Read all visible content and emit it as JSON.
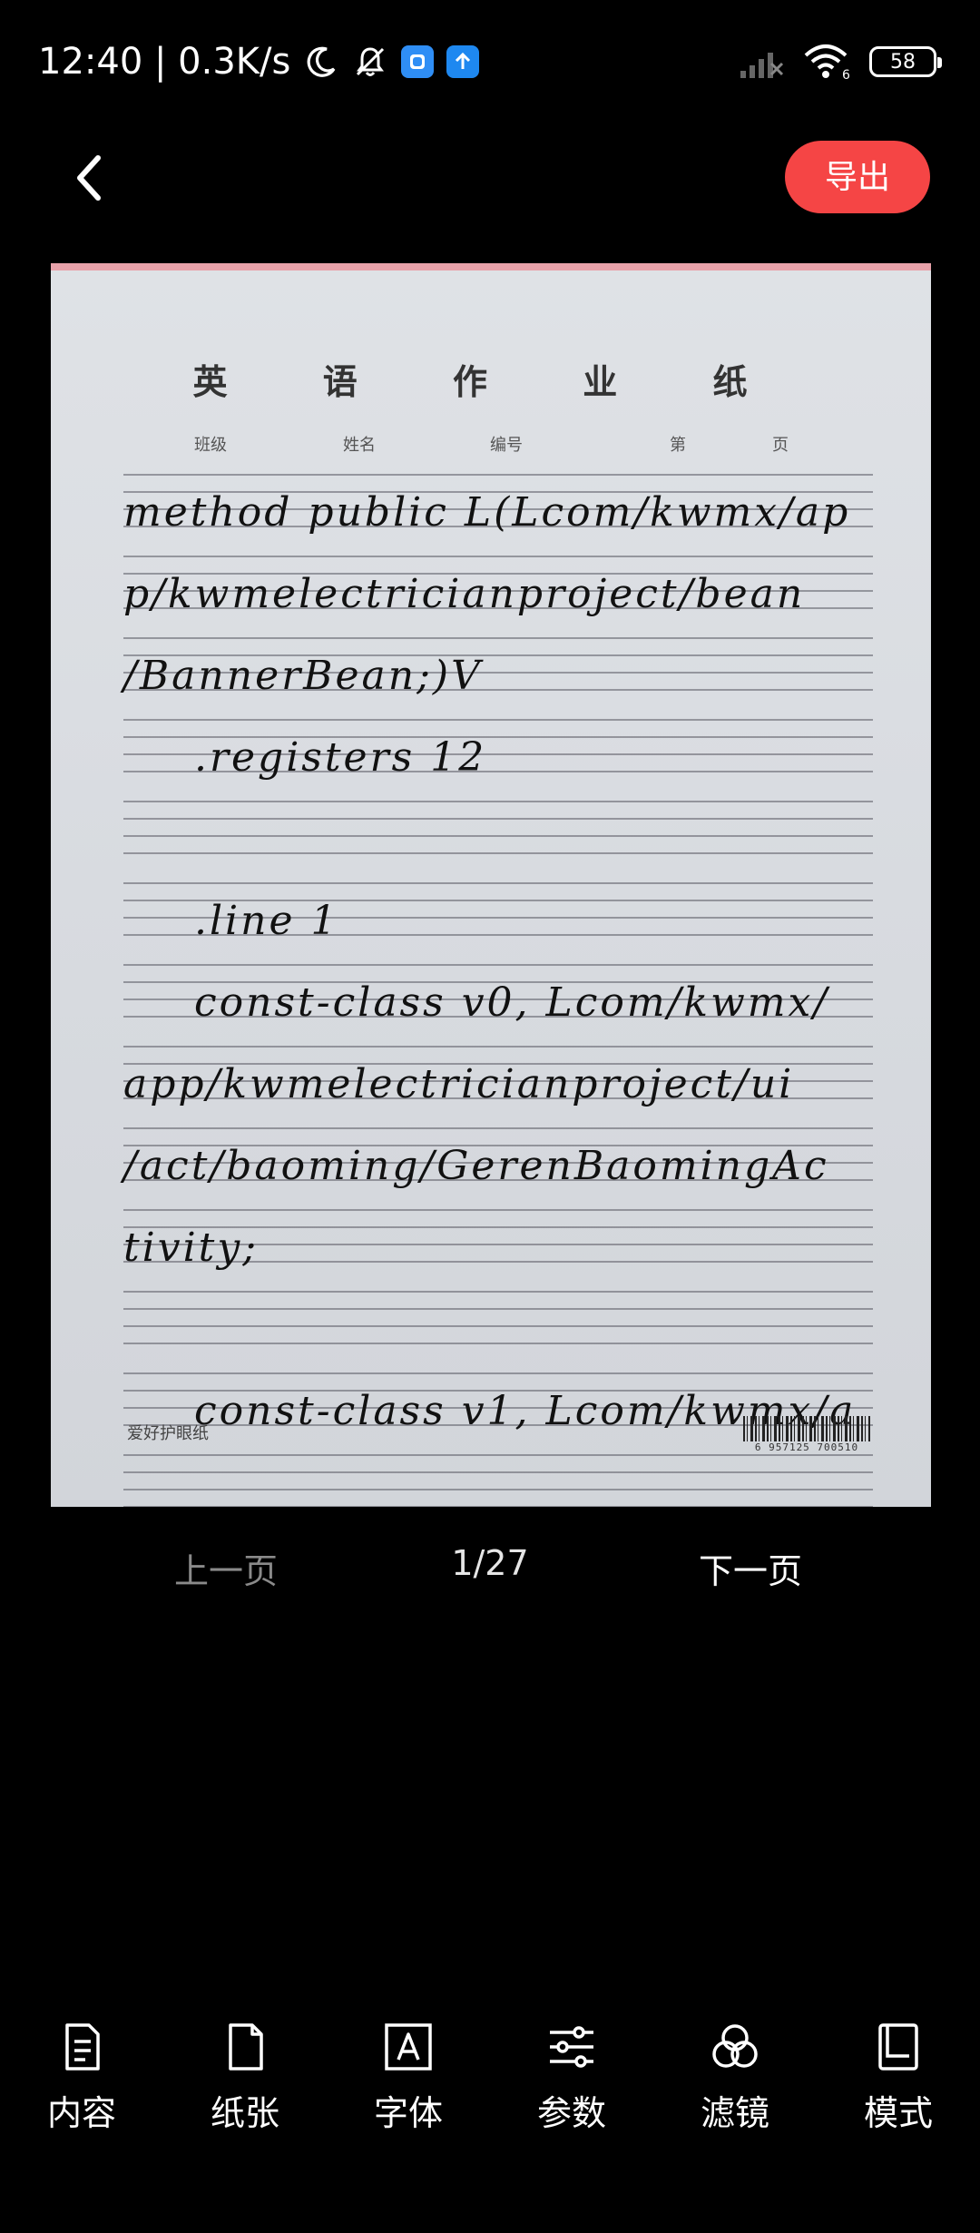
{
  "status_bar": {
    "time_speed": "12:40 | 0.3K/s",
    "battery": "58"
  },
  "header": {
    "export_label": "导出"
  },
  "paper": {
    "title": "英 语 作 业 纸",
    "fields": [
      "班级",
      "姓名",
      "编号",
      "第",
      "页"
    ],
    "lines": [
      "method public L(Lcom/kwmx/ap",
      "p/kwmelectricianproject/bean",
      "/BannerBean;)V",
      ".registers 12",
      "",
      ".line 1",
      "const-class v0, Lcom/kwmx/",
      "app/kwmelectricianproject/ui",
      "/act/baoming/GerenBaomingAc",
      "tivity;",
      "",
      "const-class v1, Lcom/kwmx/a"
    ],
    "footer_brand": "爱好护眼纸",
    "barcode_digits": "6 957125 700510"
  },
  "pager": {
    "prev_label": "上一页",
    "count": "1/27",
    "next_label": "下一页"
  },
  "toolbar": {
    "items": [
      {
        "label": "内容",
        "icon": "document-lines-icon"
      },
      {
        "label": "纸张",
        "icon": "paper-icon"
      },
      {
        "label": "字体",
        "icon": "font-a-icon"
      },
      {
        "label": "参数",
        "icon": "sliders-icon"
      },
      {
        "label": "滤镜",
        "icon": "filter-circles-icon"
      },
      {
        "label": "模式",
        "icon": "mode-pages-icon"
      }
    ]
  },
  "colors": {
    "accent": "#F54545",
    "background": "#000000"
  }
}
